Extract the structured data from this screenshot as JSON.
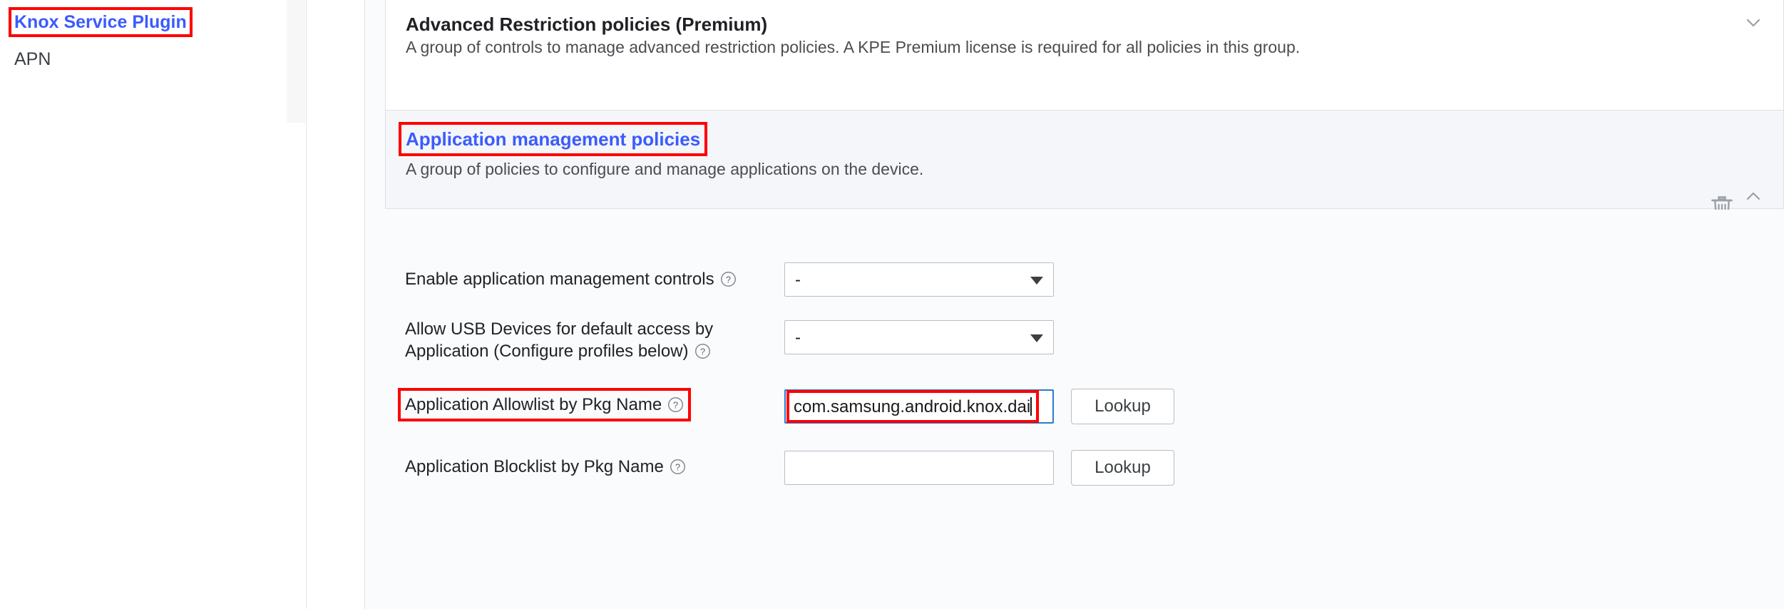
{
  "sidebar": {
    "items": [
      {
        "label": "Knox Service Plugin",
        "state": "selected"
      },
      {
        "label": "APN",
        "state": "normal"
      }
    ],
    "scrollbar": {
      "name": "vertical-scrollbar"
    }
  },
  "main": {
    "groups": [
      {
        "title": "Advanced Restriction policies (Premium)",
        "description": "A group of controls to manage advanced restriction policies. A KPE Premium license is required for all policies in this group.",
        "expanded": false,
        "chevron": "chevron-down-icon",
        "has_delete": false
      },
      {
        "title": "Application management policies",
        "description": "A group of policies to configure and manage applications on the device.",
        "expanded": true,
        "chevron": "chevron-up-icon",
        "has_delete": true,
        "delete_icon": "trash-icon"
      }
    ],
    "rows": [
      {
        "label": "Enable application management controls",
        "help_icon": "help-circle-icon",
        "control": "select",
        "value": "-",
        "caret": "caret-down-icon"
      },
      {
        "label": "Allow USB Devices for default access by Application (Configure profiles below)",
        "help_icon": "help-circle-icon",
        "control": "select",
        "value": "-",
        "caret": "caret-down-icon"
      },
      {
        "label": "Application Allowlist by Pkg Name",
        "help_icon": "help-circle-icon",
        "control": "text",
        "value": "com.samsung.android.knox.dai",
        "placeholder": "",
        "focused": true,
        "button_label": "Lookup"
      },
      {
        "label": "Application Blocklist by Pkg Name",
        "help_icon": "help-circle-icon",
        "control": "text",
        "value": "",
        "placeholder": "",
        "focused": false,
        "button_label": "Lookup"
      }
    ]
  },
  "annotations": {
    "highlight_color": "#ff0000",
    "boxes": [
      {
        "target": "sidebar-item-knox-service-plugin"
      },
      {
        "target": "group-title-application-management-policies"
      },
      {
        "target": "row-label-application-allowlist-by-pkg-name"
      },
      {
        "target": "text-input-application-allowlist"
      }
    ]
  },
  "colors": {
    "link_blue": "#3b5bfd",
    "focus_blue": "#2a7ad2",
    "section_bg": "#f4f6f9",
    "page_bg": "#fafbfd"
  }
}
